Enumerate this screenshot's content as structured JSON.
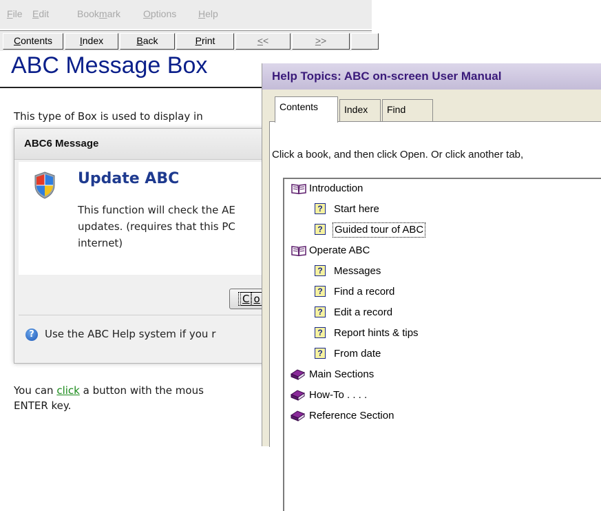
{
  "menu": {
    "items": [
      {
        "pre": "",
        "u": "F",
        "post": "ile"
      },
      {
        "pre": "",
        "u": "E",
        "post": "dit"
      },
      {
        "pre": "Book",
        "u": "m",
        "post": "ark"
      },
      {
        "pre": "",
        "u": "O",
        "post": "ptions"
      },
      {
        "pre": "",
        "u": "H",
        "post": "elp"
      }
    ]
  },
  "toolbar": {
    "contents": {
      "u": "C",
      "post": "ontents"
    },
    "index": {
      "u": "I",
      "post": "ndex"
    },
    "back": {
      "u": "B",
      "post": "ack"
    },
    "print": {
      "u": "P",
      "post": "rint"
    },
    "prev": {
      "u": "<",
      "post": "<"
    },
    "next": {
      "u": ">",
      "post": ">"
    }
  },
  "doc": {
    "title": "ABC Message Box",
    "intro": "This type of Box is used to display in",
    "bottom_pre": "You can ",
    "bottom_link": "click",
    "bottom_post": " a button with the mous",
    "bottom_line2": "ENTER key."
  },
  "message_box": {
    "title": "ABC6 Message",
    "heading": "Update ABC",
    "body_line1": "This function will check the AE",
    "body_line2": "updates. (requires that this PC",
    "body_line3": "internet)",
    "button_u": "C",
    "button_post": "o",
    "footer": "Use the ABC Help system if you r"
  },
  "help_topics": {
    "title": "Help Topics: ABC on-screen User Manual",
    "tabs": [
      "Contents",
      "Index",
      "Find"
    ],
    "instruction": "Click a book, and then click Open. Or click another tab,",
    "tree": [
      {
        "label": "Introduction",
        "icon": "open-book-icon",
        "level": 0
      },
      {
        "label": "Start here",
        "icon": "help-topic-icon",
        "level": 1
      },
      {
        "label": "Guided tour of ABC",
        "icon": "help-topic-icon",
        "level": 1,
        "selected": true
      },
      {
        "label": "Operate ABC",
        "icon": "open-book-icon",
        "level": 0
      },
      {
        "label": "Messages",
        "icon": "help-topic-icon",
        "level": 1
      },
      {
        "label": "Find a record",
        "icon": "help-topic-icon",
        "level": 1
      },
      {
        "label": "Edit a record",
        "icon": "help-topic-icon",
        "level": 1
      },
      {
        "label": "Report hints & tips",
        "icon": "help-topic-icon",
        "level": 1
      },
      {
        "label": "From date",
        "icon": "help-topic-icon",
        "level": 1
      },
      {
        "label": "Main Sections",
        "icon": "closed-book-icon",
        "level": 0
      },
      {
        "label": "How-To . . . .",
        "icon": "closed-book-icon",
        "level": 0
      },
      {
        "label": "Reference Section",
        "icon": "closed-book-icon",
        "level": 0
      }
    ]
  },
  "colors": {
    "doc_title": "#0a1f8a",
    "dialog_title": "#3a1a7a",
    "message_heading": "#1e3a8f",
    "link": "#1a8a1a",
    "book": "#6a1f7a"
  }
}
